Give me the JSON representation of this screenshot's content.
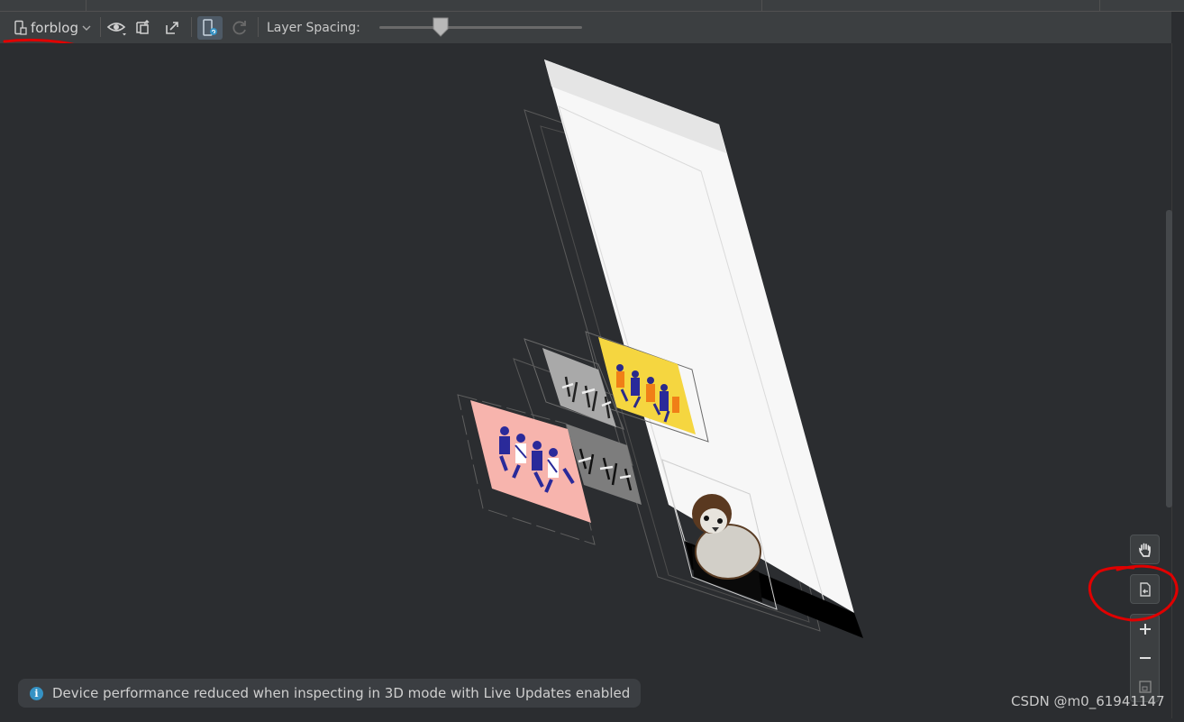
{
  "toolbar": {
    "device_name": "forblog",
    "layer_spacing_label": "Layer Spacing:",
    "layer_spacing_value": 0.3
  },
  "notice": {
    "text": "Device performance reduced when inspecting in 3D mode with Live Updates enabled"
  },
  "watermark": "CSDN @m0_61941147",
  "colors": {
    "background": "#2b2d30",
    "toolbar": "#3c3f41",
    "annotation": "#e00000",
    "info": "#3592c4"
  },
  "icons": [
    "device-icon",
    "chevron-down-icon",
    "eye-icon",
    "export-layout-icon",
    "share-icon",
    "live-updates-icon",
    "refresh-icon",
    "pan-hand-icon",
    "reset-view-icon",
    "zoom-in-icon",
    "zoom-out-icon",
    "fit-screen-icon",
    "info-icon"
  ]
}
